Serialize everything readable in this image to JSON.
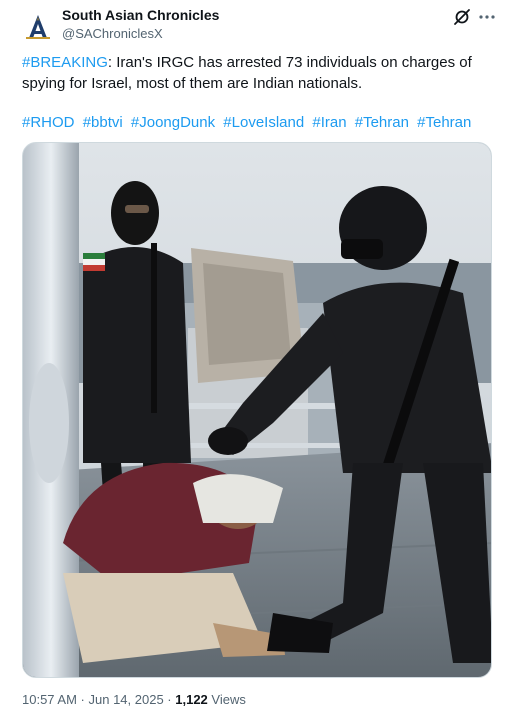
{
  "author": {
    "display_name": "South Asian Chronicles",
    "handle": "@SAChroniclesX",
    "avatar_letter": "A"
  },
  "tweet": {
    "breaking_tag": "#BREAKING",
    "body": ": Iran's IRGC has arrested 73 individuals on charges of spying for Israel, most of them are Indian nationals.",
    "hashtags": [
      "#RHOD",
      "#bbtvi",
      "#JoongDunk",
      "#LoveIsland",
      "#Iran",
      "#Tehran",
      "#Tehran"
    ]
  },
  "meta": {
    "time": "10:57 AM",
    "separator": " · ",
    "date": "Jun 14, 2025",
    "views_count": "1,122",
    "views_label": " Views"
  },
  "icons": {
    "grok": "grok-icon",
    "more": "more-icon",
    "avatar": "avatar-logo"
  },
  "colors": {
    "link": "#1d9bf0",
    "text": "#0f1419",
    "secondary": "#536471"
  }
}
